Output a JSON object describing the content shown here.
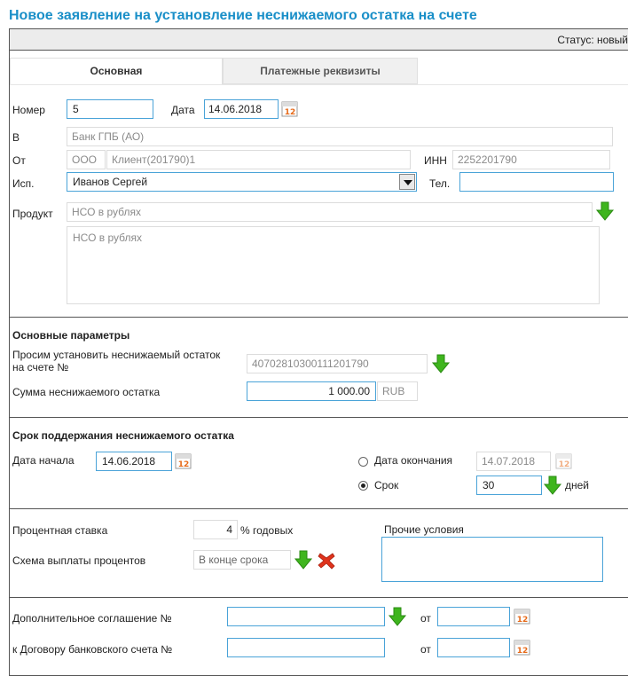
{
  "page_title": "Новое заявление на установление неснижаемого остатка на счете",
  "status": "Статус: новый",
  "tabs": [
    {
      "label": "Основная",
      "active": true
    },
    {
      "label": "Платежные реквизиты",
      "active": false
    }
  ],
  "form": {
    "number_label": "Номер",
    "number_value": "5",
    "date_label": "Дата",
    "date_value": "14.06.2018",
    "bank_label": "В",
    "bank_value": "Банк ГПБ (АО)",
    "from_label": "От",
    "from_org_type": "ООО",
    "from_client": "Клиент(201790)1",
    "inn_label": "ИНН",
    "inn_value": "2252201790",
    "executor_label": "Исп.",
    "executor_value": "Иванов Сергей",
    "phone_label": "Тел.",
    "phone_value": "",
    "product_label": "Продукт",
    "product_value": "НСО в рублях",
    "product_description": "НСО в рублях"
  },
  "main_params": {
    "section_title": "Основные параметры",
    "account_label": "Просим установить неснижаемый остаток на счете №",
    "account_value": "40702810300111201790",
    "amount_label": "Сумма неснижаемого остатка",
    "amount_value": "1 000.00",
    "currency": "RUB"
  },
  "term": {
    "section_title": "Срок поддержания неснижаемого остатка",
    "start_label": "Дата начала",
    "start_value": "14.06.2018",
    "end_radio_label": "Дата окончания",
    "end_value": "14.07.2018",
    "term_radio_label": "Срок",
    "term_value": "30",
    "days_label": "дней",
    "selected_option": "Срок"
  },
  "interest": {
    "rate_label": "Процентная ставка",
    "rate_value": "4",
    "rate_unit": "% годовых",
    "scheme_label": "Схема выплаты процентов",
    "scheme_value": "В конце срока",
    "other_label": "Прочие условия",
    "other_value": ""
  },
  "agreement": {
    "additional_label": "Дополнительное соглашение №",
    "additional_value": "",
    "from_label_1": "от",
    "from_value_1": "",
    "contract_label": "к Договору банковского счета №",
    "contract_value": "",
    "from_label_2": "от",
    "from_value_2": ""
  },
  "colors": {
    "title": "#1a8fc8",
    "input_border": "#4aa3d8",
    "green_arrow": "#3fb51e",
    "red_cross": "#e0331c"
  }
}
